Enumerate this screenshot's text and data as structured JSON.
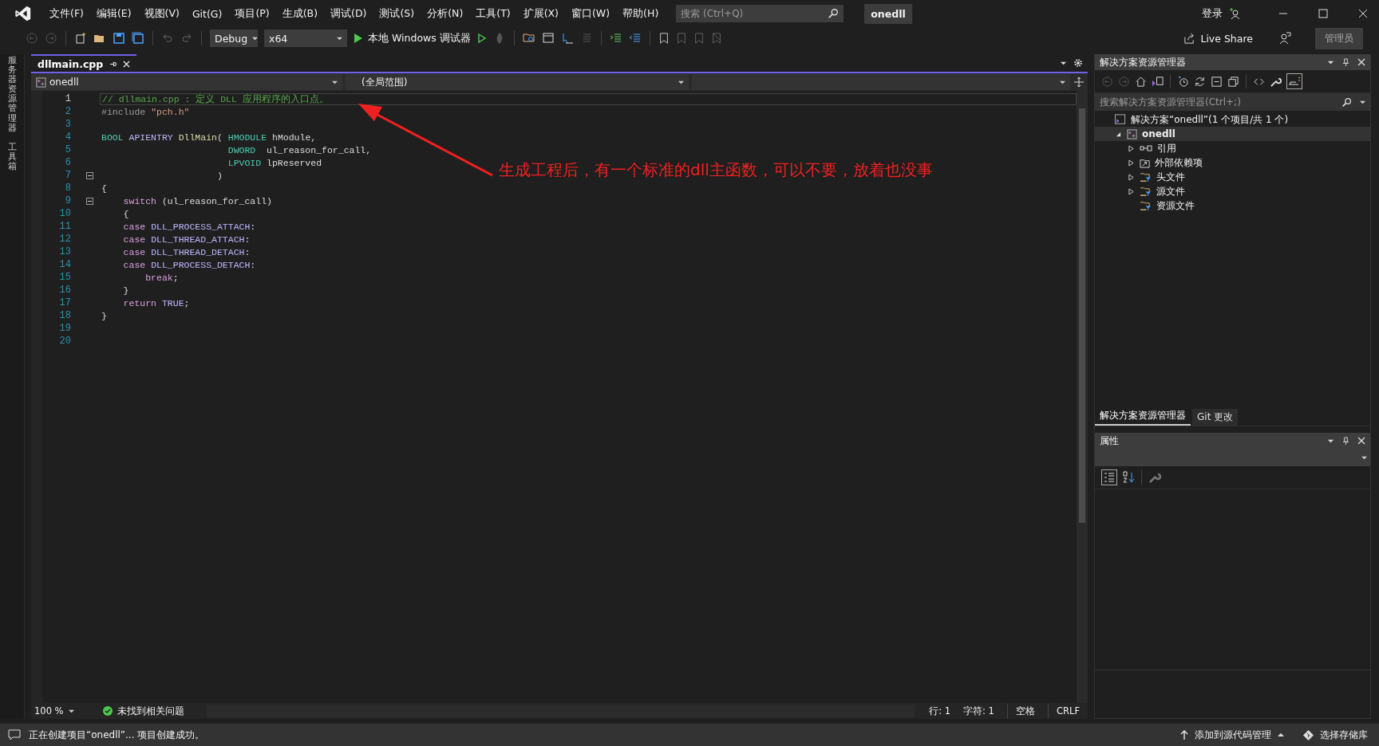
{
  "window": {
    "badge": "onedll"
  },
  "menu": [
    "文件(F)",
    "编辑(E)",
    "视图(V)",
    "Git(G)",
    "项目(P)",
    "生成(B)",
    "调试(D)",
    "测试(S)",
    "分析(N)",
    "工具(T)",
    "扩展(X)",
    "窗口(W)",
    "帮助(H)"
  ],
  "search": {
    "placeholder": "搜索 (Ctrl+Q)"
  },
  "account": {
    "sign_in": "登录"
  },
  "toolbar": {
    "configuration": "Debug",
    "platform": "x64",
    "run_label": "本地 Windows 调试器",
    "live_share": "Live Share",
    "admin": "管理员"
  },
  "side_tabs": [
    "服务器资源管理器",
    "工具箱"
  ],
  "editor": {
    "tabs": [
      {
        "label": "dllmain.cpp",
        "selected": true
      }
    ],
    "nav": {
      "project": "onedll",
      "scope": "(全局范围)"
    },
    "lines": [
      {
        "n": "1",
        "current": true,
        "fold": false,
        "tokens": [
          {
            "kind": "comment",
            "text": "// dllmain.cpp : 定义 DLL 应用程序的入口点。"
          }
        ]
      },
      {
        "n": "2",
        "current": false,
        "fold": false,
        "tokens": [
          {
            "kind": "preproc",
            "text": "#include "
          },
          {
            "kind": "string",
            "text": "\"pch.h\""
          }
        ]
      },
      {
        "n": "3",
        "current": false,
        "fold": false
      },
      {
        "n": "4",
        "current": false,
        "fold": false,
        "tokens": [
          {
            "kind": "type",
            "text": "BOOL "
          },
          {
            "kind": "macro",
            "text": "APIENTRY "
          },
          {
            "kind": "func",
            "text": "DllMain"
          },
          {
            "kind": "plain",
            "text": "( "
          },
          {
            "kind": "type",
            "text": "HMODULE"
          },
          {
            "kind": "plain",
            "text": " hModule,"
          }
        ]
      },
      {
        "n": "5",
        "current": false,
        "fold": false,
        "tokens": [
          {
            "kind": "type",
            "text": "                       DWORD"
          },
          {
            "kind": "plain",
            "text": "  ul_reason_for_call,"
          }
        ]
      },
      {
        "n": "6",
        "current": false,
        "fold": false,
        "tokens": [
          {
            "kind": "type",
            "text": "                       LPVOID"
          },
          {
            "kind": "plain",
            "text": " lpReserved"
          }
        ]
      },
      {
        "n": "7",
        "current": false,
        "fold": true,
        "tokens": [
          {
            "kind": "plain",
            "text": "                     )"
          }
        ]
      },
      {
        "n": "8",
        "current": false,
        "fold": false,
        "tokens": [
          {
            "kind": "plain",
            "text": "{"
          }
        ]
      },
      {
        "n": "9",
        "current": false,
        "fold": true,
        "tokens": [
          {
            "kind": "control",
            "text": "    switch"
          },
          {
            "kind": "plain",
            "text": " (ul_reason_for_call)"
          }
        ]
      },
      {
        "n": "10",
        "current": false,
        "fold": false,
        "tokens": [
          {
            "kind": "plain",
            "text": "    {"
          }
        ]
      },
      {
        "n": "11",
        "current": false,
        "fold": false,
        "tokens": [
          {
            "kind": "control",
            "text": "    case "
          },
          {
            "kind": "macro",
            "text": "DLL_PROCESS_ATTACH"
          },
          {
            "kind": "plain",
            "text": ":"
          }
        ]
      },
      {
        "n": "12",
        "current": false,
        "fold": false,
        "tokens": [
          {
            "kind": "control",
            "text": "    case "
          },
          {
            "kind": "macro",
            "text": "DLL_THREAD_ATTACH"
          },
          {
            "kind": "plain",
            "text": ":"
          }
        ]
      },
      {
        "n": "13",
        "current": false,
        "fold": false,
        "tokens": [
          {
            "kind": "control",
            "text": "    case "
          },
          {
            "kind": "macro",
            "text": "DLL_THREAD_DETACH"
          },
          {
            "kind": "plain",
            "text": ":"
          }
        ]
      },
      {
        "n": "14",
        "current": false,
        "fold": false,
        "tokens": [
          {
            "kind": "control",
            "text": "    case "
          },
          {
            "kind": "macro",
            "text": "DLL_PROCESS_DETACH"
          },
          {
            "kind": "plain",
            "text": ":"
          }
        ]
      },
      {
        "n": "15",
        "current": false,
        "fold": false,
        "tokens": [
          {
            "kind": "control",
            "text": "        break"
          },
          {
            "kind": "plain",
            "text": ";"
          }
        ]
      },
      {
        "n": "16",
        "current": false,
        "fold": false,
        "tokens": [
          {
            "kind": "plain",
            "text": "    }"
          }
        ]
      },
      {
        "n": "17",
        "current": false,
        "fold": false,
        "tokens": [
          {
            "kind": "control",
            "text": "    return "
          },
          {
            "kind": "macro",
            "text": "TRUE"
          },
          {
            "kind": "plain",
            "text": ";"
          }
        ]
      },
      {
        "n": "18",
        "current": false,
        "fold": false,
        "tokens": [
          {
            "kind": "plain",
            "text": "}"
          }
        ]
      },
      {
        "n": "19",
        "current": false,
        "fold": false
      },
      {
        "n": "20",
        "current": false,
        "fold": false
      }
    ],
    "footer": {
      "zoom": "100 %",
      "issues": "未找到相关问题",
      "line": "行: 1",
      "char": "字符: 1",
      "spacing": "空格",
      "eol": "CRLF"
    }
  },
  "annotation": {
    "text": "生成工程后，有一个标准的dll主函数，可以不要，放着也没事"
  },
  "solution_explorer": {
    "title": "解决方案资源管理器",
    "search": {
      "placeholder": "搜索解决方案资源管理器(Ctrl+;)"
    },
    "tree": [
      {
        "label": "解决方案“onedll”(1 个项目/共 1 个)",
        "kind": "solution",
        "selected": false,
        "expandable": false,
        "expanded": true,
        "children": [
          {
            "label": "onedll",
            "kind": "project",
            "selected": true,
            "expandable": true,
            "expanded": true,
            "children": [
              {
                "label": "引用",
                "kind": "reference",
                "selected": false,
                "expandable": true,
                "expanded": false
              },
              {
                "label": "外部依赖项",
                "kind": "external",
                "selected": false,
                "expandable": true,
                "expanded": false
              },
              {
                "label": "头文件",
                "kind": "filter",
                "selected": false,
                "expandable": true,
                "expanded": false
              },
              {
                "label": "源文件",
                "kind": "filter",
                "selected": false,
                "expandable": true,
                "expanded": false
              },
              {
                "label": "资源文件",
                "kind": "filter",
                "selected": false,
                "expandable": false,
                "expanded": false
              }
            ]
          }
        ]
      }
    ]
  },
  "panel_tabs": [
    {
      "label": "解决方案资源管理器",
      "selected": true
    },
    {
      "label": "Git 更改",
      "selected": false
    }
  ],
  "properties": {
    "title": "属性"
  },
  "status_bar": {
    "message": "正在创建项目“onedll”... 项目创建成功。",
    "source_control": "添加到源代码管理",
    "repository": "选择存储库"
  }
}
